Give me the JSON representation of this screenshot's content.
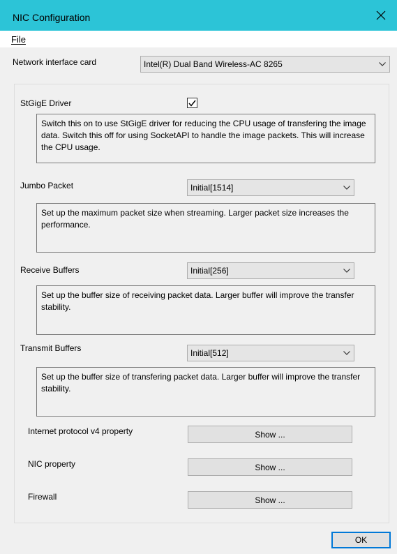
{
  "window": {
    "title": "NIC Configuration",
    "close_icon": "close-icon",
    "accent_color": "#2cc4d7"
  },
  "menu": {
    "file": "File"
  },
  "nic": {
    "label": "Network interface card",
    "selected": "Intel(R) Dual Band Wireless-AC 8265"
  },
  "stgige": {
    "label": "StGigE Driver",
    "checked": true,
    "description": "Switch this on to use StGigE driver for reducing the CPU usage of transfering the image data. Switch this off for using SocketAPI to handle the image packets. This will increase the CPU usage."
  },
  "jumbo": {
    "label": "Jumbo Packet",
    "selected": "Initial[1514]",
    "description": "Set up the maximum packet size when streaming. Larger packet size increases the performance."
  },
  "receive": {
    "label": "Receive Buffers",
    "selected": "Initial[256]",
    "description": "Set up the buffer size of receiving packet data. Larger buffer will improve the transfer stability."
  },
  "transmit": {
    "label": "Transmit Buffers",
    "selected": "Initial[512]",
    "description": "Set up the buffer size of transfering packet data. Larger buffer will improve the transfer stability."
  },
  "ipv4": {
    "label": "Internet protocol v4 property",
    "button": "Show ..."
  },
  "nic_property": {
    "label": "NIC property",
    "button": "Show ..."
  },
  "firewall": {
    "label": "Firewall",
    "button": "Show ..."
  },
  "footer": {
    "ok": "OK"
  }
}
